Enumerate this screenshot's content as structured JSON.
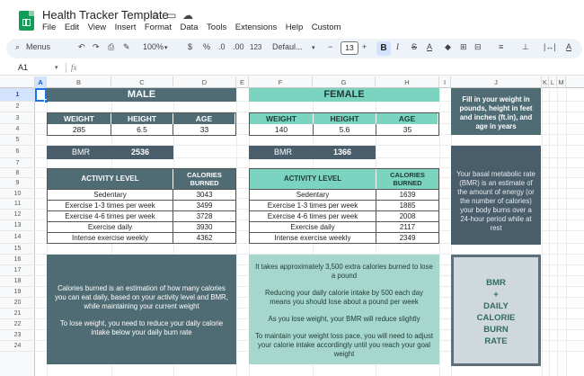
{
  "app": {
    "title": "Health Tracker Template",
    "menus": [
      "File",
      "Edit",
      "View",
      "Insert",
      "Format",
      "Data",
      "Tools",
      "Extensions",
      "Help",
      "Custom"
    ]
  },
  "toolbar": {
    "menus_label": "Menus",
    "zoom": "100%",
    "currency": "$",
    "percent": "%",
    "dec_decrease": ".0",
    "dec_increase": ".00",
    "number_format": "123",
    "font": "Defaul...",
    "font_size": "13",
    "bold": "B",
    "italic": "I",
    "strike": "S",
    "text_color": "A"
  },
  "formula_bar": {
    "cell_ref": "A1",
    "fx": "fx",
    "value": ""
  },
  "columns": [
    "A",
    "B",
    "C",
    "D",
    "E",
    "F",
    "G",
    "H",
    "I",
    "J",
    "K",
    "L",
    "M"
  ],
  "rows": [
    "1",
    "2",
    "3",
    "4",
    "5",
    "6",
    "7",
    "8",
    "9",
    "10",
    "11",
    "12",
    "13",
    "14",
    "15",
    "16",
    "17",
    "18",
    "19",
    "20",
    "21",
    "22",
    "23",
    "24"
  ],
  "colors": {
    "male_banner": "#4f6b73",
    "female_banner": "#7ad4c0",
    "male_header": "#4f6b73",
    "female_header": "#7ad4c0",
    "info_dark": "#4a5d6b",
    "note_male": "#4f6b73",
    "note_female": "#a6d7cd",
    "bmr_box": "#cfd8dc"
  },
  "male": {
    "banner": "MALE",
    "headers": [
      "WEIGHT",
      "HEIGHT",
      "AGE"
    ],
    "values": [
      "285",
      "6.5",
      "33"
    ],
    "bmr_label": "BMR",
    "bmr_value": "2536",
    "activity_header": "ACTIVITY LEVEL",
    "calories_header": "CALORIES BURNED",
    "activities": [
      {
        "level": "Sedentary",
        "calories": "3043"
      },
      {
        "level": "Exercise 1-3 times per week",
        "calories": "3499"
      },
      {
        "level": "Exercise 4-6 times per week",
        "calories": "3728"
      },
      {
        "level": "Exercise daily",
        "calories": "3930"
      },
      {
        "level": "Intense exercise weekly",
        "calories": "4362"
      }
    ],
    "note_p1": "Calories burned is an estimation of how many calories you can eat daily, based on your activity level and BMR, while maintaining your current weight",
    "note_p2": "To lose weight, you need to reduce your daily calorie intake below your daily burn rate"
  },
  "female": {
    "banner": "FEMALE",
    "headers": [
      "WEIGHT",
      "HEIGHT",
      "AGE"
    ],
    "values": [
      "140",
      "5.6",
      "35"
    ],
    "bmr_label": "BMR",
    "bmr_value": "1366",
    "activity_header": "ACTIVITY LEVEL",
    "calories_header": "CALORIES BURNED",
    "activities": [
      {
        "level": "Sedentary",
        "calories": "1639"
      },
      {
        "level": "Exercise 1-3 times per week",
        "calories": "1885"
      },
      {
        "level": "Exercise 4-6 times per week",
        "calories": "2008"
      },
      {
        "level": "Exercise daily",
        "calories": "2117"
      },
      {
        "level": "Intense exercise weekly",
        "calories": "2349"
      }
    ],
    "note_p1": "It takes approximately 3,500 extra calories burned to lose a pound",
    "note_p2": "Reducing your daily calorie intake by 500 each day means you should lose about a pound per week",
    "note_p3": "As you lose weight, your BMR will reduce slightly",
    "note_p4": "To maintain your weight loss pace, you will need to adjust your calorie intake accordingly until you reach your goal weight"
  },
  "info": {
    "fill_in": "Fill in your weight in pounds, height in feet and inches (ft.in), and age in years",
    "bmr_desc": "Your basal metabolic rate (BMR) is an estimate of the amount of energy (or the number of calories) your body burns over a 24-hour period while at rest",
    "bmr_box": [
      "BMR",
      "+",
      "DAILY",
      "CALORIE",
      "BURN",
      "RATE"
    ]
  }
}
